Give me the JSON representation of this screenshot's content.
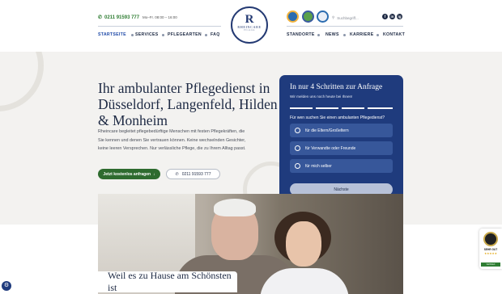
{
  "header": {
    "phone": "0211 91593 777",
    "hours": "Mo–Fr. 08:00 – 16:00",
    "logo": {
      "title": "RHEINCARE",
      "tagline": "PFLEGE"
    },
    "search_placeholder": "Suchbegriff...",
    "nav_left": [
      "STARTSEITE",
      "SERVICES",
      "PFLEGEARTEN",
      "FAQ"
    ],
    "nav_right": [
      "STANDORTE",
      "NEWS",
      "KARRIERE",
      "KONTAKT"
    ],
    "social": [
      "f",
      "in",
      "ig"
    ],
    "colors": {
      "primary": "#1f3b7d",
      "green": "#2e6b2f"
    }
  },
  "hero": {
    "headline": "Ihr ambulanter Pflegedienst in Düsseldorf, Langenfeld, Hilden & Monheim",
    "intro": "Rheincare begleitet pflegebedürftige Menschen mit festen Pflegekräften, die Sie kennen und denen Sie vertrauen können. Keine wechselnden Gesichter, keine leeren Versprechen. Nur verlässliche Pflege, die zu Ihrem Alltag passt.",
    "cta_primary": "Jetzt kostenlos anfragen",
    "cta_phone": "0211 91593 777"
  },
  "form": {
    "title": "In nur 4 Schritten zur Anfrage",
    "callback": "Wir melden uns noch heute bei Ihnen!",
    "steps_total": 4,
    "question": "Für wen suchen Sie einen ambulanten Pflegedienst?",
    "options": [
      "für die Eltern/Großeltern",
      "für Verwandte oder Freunde",
      "für mich selber"
    ],
    "next": "Nächste"
  },
  "section": {
    "caption": "Weil es zu Hause am Schönsten ist"
  },
  "seal": {
    "label": "SEHR GUT",
    "stars": "★★★★★",
    "band": "Verifiziert"
  }
}
